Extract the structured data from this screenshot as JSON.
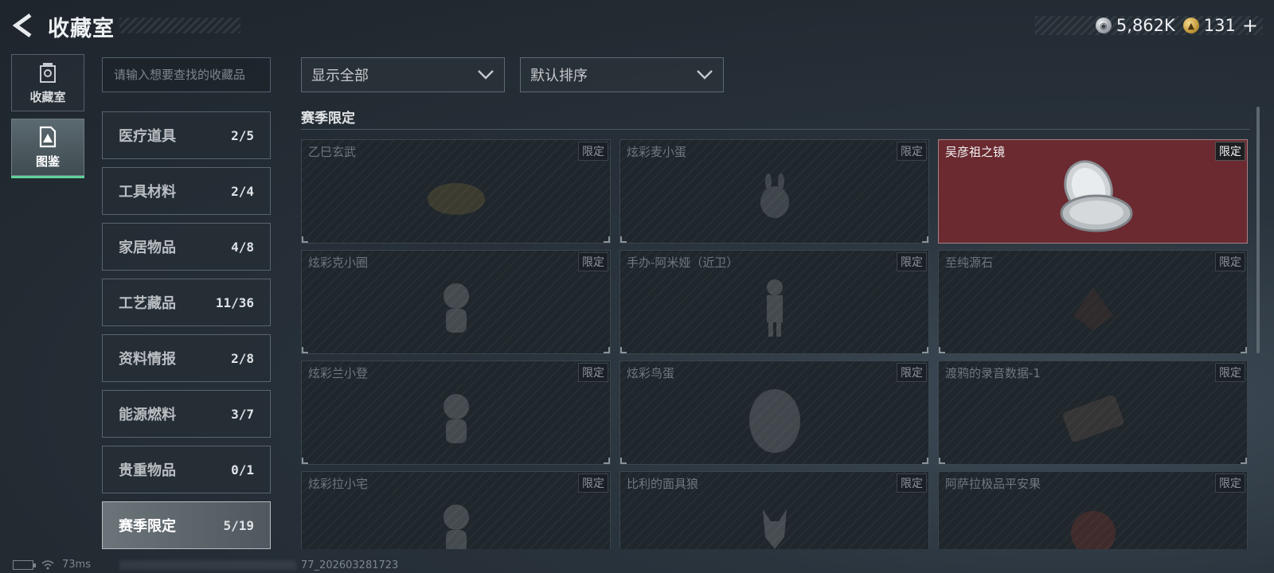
{
  "header": {
    "title": "收藏室",
    "currency": [
      {
        "icon": "silver-coin-icon",
        "value": "5,862K"
      },
      {
        "icon": "gold-coin-icon",
        "value": "131"
      }
    ],
    "add_label": "+"
  },
  "nav": {
    "tabs": [
      {
        "label": "收藏室",
        "icon": "collection-room-icon",
        "active": false
      },
      {
        "label": "图鉴",
        "icon": "codex-icon",
        "active": true
      }
    ]
  },
  "search": {
    "placeholder": "请输入想要查找的收藏品"
  },
  "categories": [
    {
      "name": "医疗道具",
      "count": "2/5"
    },
    {
      "name": "工具材料",
      "count": "2/4"
    },
    {
      "name": "家居物品",
      "count": "4/8"
    },
    {
      "name": "工艺藏品",
      "count": "11/36"
    },
    {
      "name": "资料情报",
      "count": "2/8"
    },
    {
      "name": "能源燃料",
      "count": "3/7"
    },
    {
      "name": "贵重物品",
      "count": "0/1"
    },
    {
      "name": "赛季限定",
      "count": "5/19",
      "active": true
    }
  ],
  "filters": {
    "show": "显示全部",
    "sort": "默认排序"
  },
  "section": {
    "title": "赛季限定"
  },
  "items": [
    {
      "name": "乙巳玄武",
      "tag": "限定",
      "owned": false
    },
    {
      "name": "炫彩麦小蛋",
      "tag": "限定",
      "owned": false
    },
    {
      "name": "吴彦祖之镜",
      "tag": "限定",
      "owned": true
    },
    {
      "name": "炫彩克小圈",
      "tag": "限定",
      "owned": false
    },
    {
      "name": "手办-阿米娅（近卫）",
      "tag": "限定",
      "owned": false
    },
    {
      "name": "至纯源石",
      "tag": "限定",
      "owned": false
    },
    {
      "name": "炫彩兰小登",
      "tag": "限定",
      "owned": false
    },
    {
      "name": "炫彩鸟蛋",
      "tag": "限定",
      "owned": false
    },
    {
      "name": "渡鸦的录音数据-1",
      "tag": "限定",
      "owned": false
    },
    {
      "name": "炫彩拉小宅",
      "tag": "限定",
      "owned": false
    },
    {
      "name": "比利的面具狼",
      "tag": "限定",
      "owned": false
    },
    {
      "name": "阿萨拉极品平安果",
      "tag": "限定",
      "owned": false
    }
  ],
  "status": {
    "ping": "73ms",
    "uid": "77_202603281723"
  },
  "colors": {
    "owned_card": "#6a2a30",
    "active_accent": "#5fd39a",
    "background": "#232b33"
  }
}
